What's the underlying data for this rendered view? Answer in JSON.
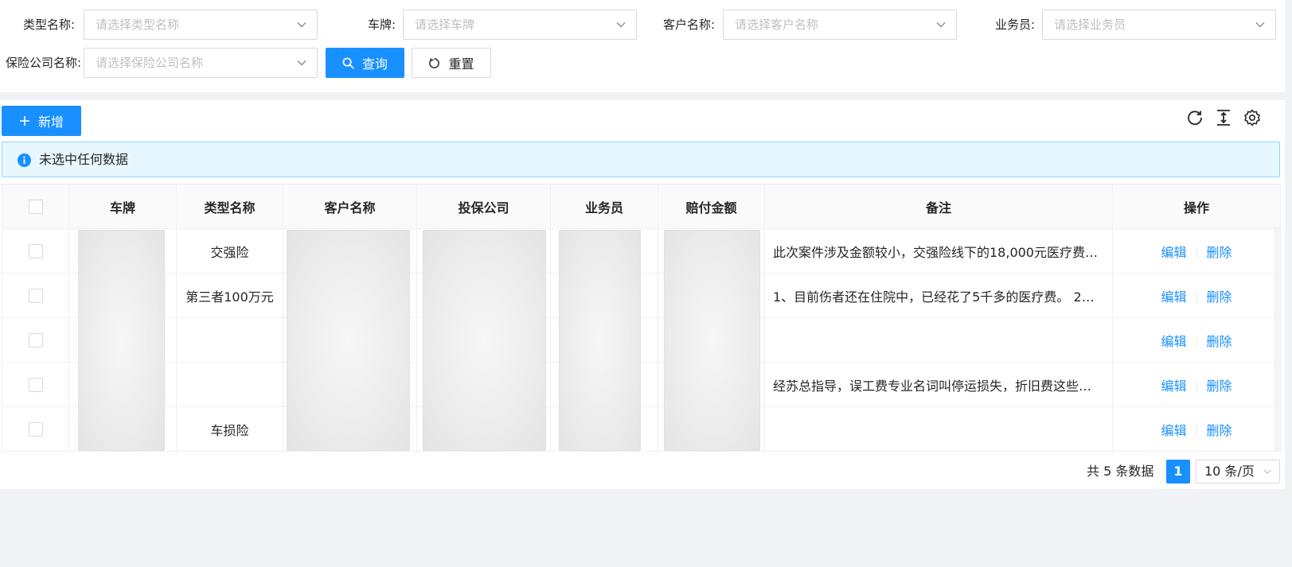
{
  "search": {
    "fields": [
      {
        "label": "类型名称:",
        "placeholder": "请选择类型名称"
      },
      {
        "label": "车牌:",
        "placeholder": "请选择车牌"
      },
      {
        "label": "客户名称:",
        "placeholder": "请选择客户名称"
      },
      {
        "label": "业务员:",
        "placeholder": "请选择业务员"
      },
      {
        "label": "保险公司名称:",
        "placeholder": "请选择保险公司名称"
      }
    ],
    "query_label": "查询",
    "reset_label": "重置"
  },
  "toolbar": {
    "add_label": "新增",
    "icons": [
      "reload-icon",
      "column-height-icon",
      "setting-icon"
    ]
  },
  "alert": {
    "text": "未选中任何数据"
  },
  "table": {
    "columns": [
      "车牌",
      "类型名称",
      "客户名称",
      "投保公司",
      "业务员",
      "赔付金额",
      "备注",
      "操作"
    ],
    "rows": [
      {
        "type": "交强险",
        "remark": "此次案件涉及金额较小，交强险线下的18,000元医疗费…"
      },
      {
        "type": "第三者100万元",
        "remark": "1、目前伤者还在住院中，已经花了5千多的医疗费。 2…"
      },
      {
        "type": "",
        "remark": ""
      },
      {
        "type": "",
        "remark": "经苏总指导，误工费专业名词叫停运损失，折旧费这些…"
      },
      {
        "type": "车损险",
        "remark": ""
      }
    ],
    "edit_label": "编辑",
    "delete_label": "删除"
  },
  "pagination": {
    "total_text": "共 5 条数据",
    "current_page": "1",
    "page_size": "10 条/页"
  },
  "colors": {
    "primary": "#1890ff",
    "alert_bg": "#e6f7ff",
    "alert_border": "#91d5ff"
  }
}
